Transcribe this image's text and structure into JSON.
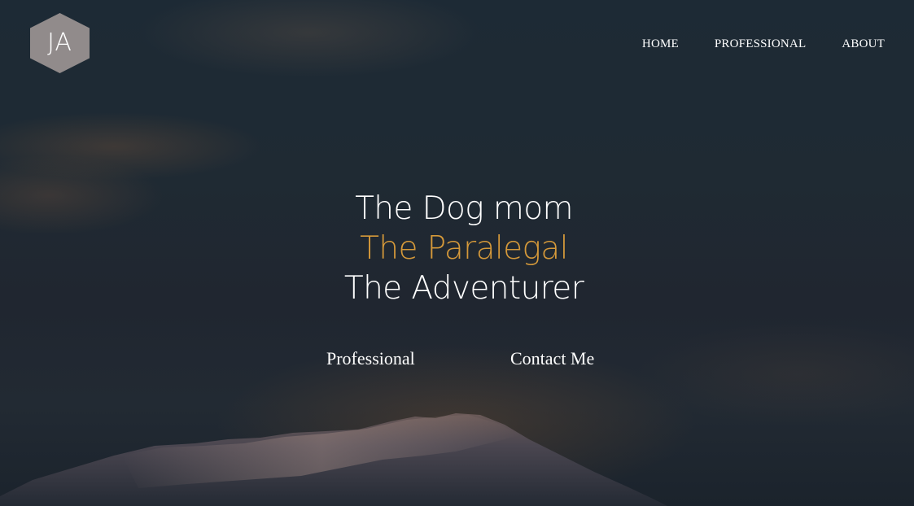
{
  "logo": {
    "initials": "JA",
    "color": "#918b8b"
  },
  "nav": {
    "items": [
      {
        "label": "HOME"
      },
      {
        "label": "PROFESSIONAL"
      },
      {
        "label": "ABOUT"
      }
    ]
  },
  "hero": {
    "lines": [
      "The Dog mom",
      "The Paralegal",
      "The Adventurer"
    ],
    "accent_color": "#d5993a",
    "buttons": [
      {
        "label": "Professional"
      },
      {
        "label": "Contact Me"
      }
    ]
  },
  "colors": {
    "background": "#1c2631",
    "text": "#ffffff"
  }
}
